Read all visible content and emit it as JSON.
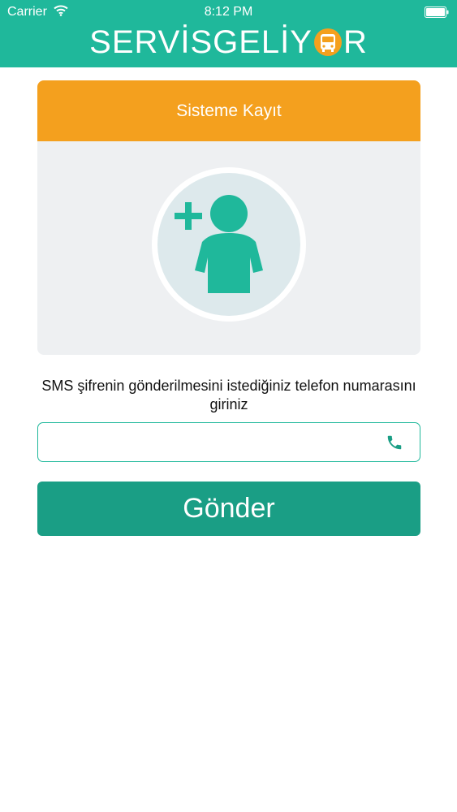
{
  "status_bar": {
    "carrier": "Carrier",
    "time": "8:12 PM"
  },
  "header": {
    "logo_left": "SERVİSGELİY",
    "logo_right": "R"
  },
  "card": {
    "title": "Sisteme Kayıt",
    "avatar_icon": "add-user-icon"
  },
  "form": {
    "instruction": "SMS şifrenin gönderilmesini istediğiniz telefon numarasını giriniz",
    "phone_value": "",
    "phone_placeholder": "",
    "phone_icon": "phone-icon",
    "submit_label": "Gönder"
  },
  "colors": {
    "primary": "#1fb89b",
    "button": "#1a9e85",
    "accent": "#f4a01e",
    "card_bg": "#eef0f2"
  }
}
